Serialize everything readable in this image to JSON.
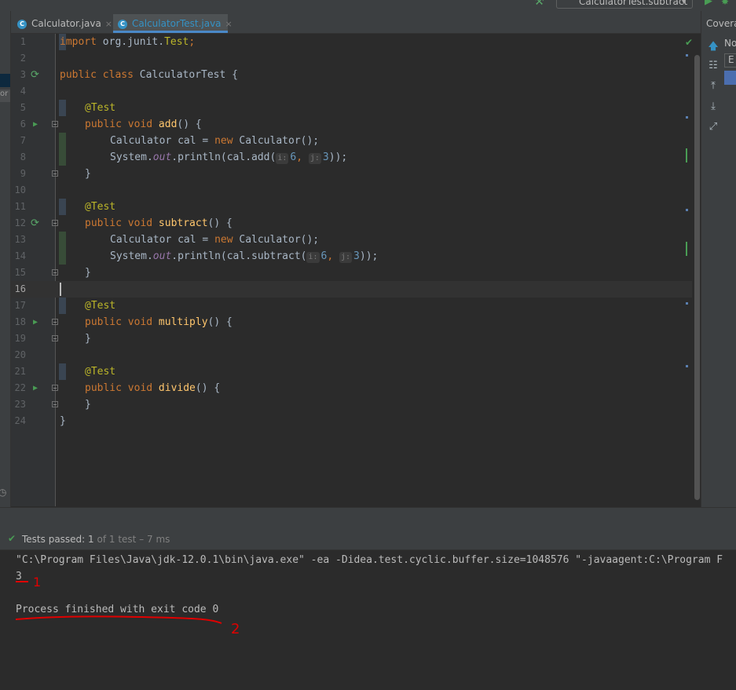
{
  "run_config": {
    "label": "CalculatorTest.subtract"
  },
  "tabs": [
    {
      "label": "Calculator.java",
      "close": "×"
    },
    {
      "label": "CalculatorTest.java",
      "close": "×"
    }
  ],
  "left_strip": {
    "fragment": "or"
  },
  "right_panel": {
    "title": "Coverage",
    "no_label": "No",
    "box_label": "E"
  },
  "line_numbers": [
    "1",
    "2",
    "3",
    "4",
    "5",
    "6",
    "7",
    "8",
    "9",
    "10",
    "11",
    "12",
    "13",
    "14",
    "15",
    "16",
    "17",
    "18",
    "19",
    "20",
    "21",
    "22",
    "23",
    "24"
  ],
  "code": {
    "l1_kw": "import",
    "l1_rest": " org.junit.",
    "l1_ann": "Test",
    "l1_end": ";",
    "l3_kw": "public class",
    "l3_rest": " CalculatorTest {",
    "ann_test": "@Test",
    "kw_pv": "public void",
    "m_add": "add",
    "m_subtract": "subtract",
    "m_multiply": "multiply",
    "m_divide": "divide",
    "sig_end": "() {",
    "decl_a": "Calculator cal = ",
    "decl_new": "new",
    "decl_b": " Calculator();",
    "print_a": "System.",
    "print_out": "out",
    "print_b": ".println(cal.add(",
    "print_b2": ".println(cal.subtract(",
    "hint_i": "i:",
    "hint_j": "j:",
    "arg1": "6",
    "comma": ",",
    "arg2": "3",
    "print_end": "));",
    "close_brace": "}"
  },
  "status": {
    "prefix": "Tests passed: ",
    "passed": "1",
    "suffix": " of 1 test – 7 ms"
  },
  "console": {
    "command": "\"C:\\Program Files\\Java\\jdk-12.0.1\\bin\\java.exe\" -ea -Didea.test.cyclic.buffer.size=1048576 \"-javaagent:C:\\Program F",
    "output": "3",
    "finish": "Process finished with exit code 0",
    "annotation_1": "1",
    "annotation_2": "2"
  },
  "colors": {
    "keyword": "#cc7832",
    "annotation": "#bbb529",
    "method": "#ffc66d",
    "number": "#6897bb",
    "pass": "#499c54",
    "red_mark": "#e00000"
  },
  "icons": [
    "hammer-icon",
    "run-icon",
    "debug-icon",
    "class-icon",
    "close-icon",
    "run-gutter-icon",
    "fold-icon",
    "checkmark-icon",
    "arrow-up-icon",
    "tree-icon",
    "export-icon",
    "import-icon",
    "expand-icon",
    "clock-icon"
  ]
}
